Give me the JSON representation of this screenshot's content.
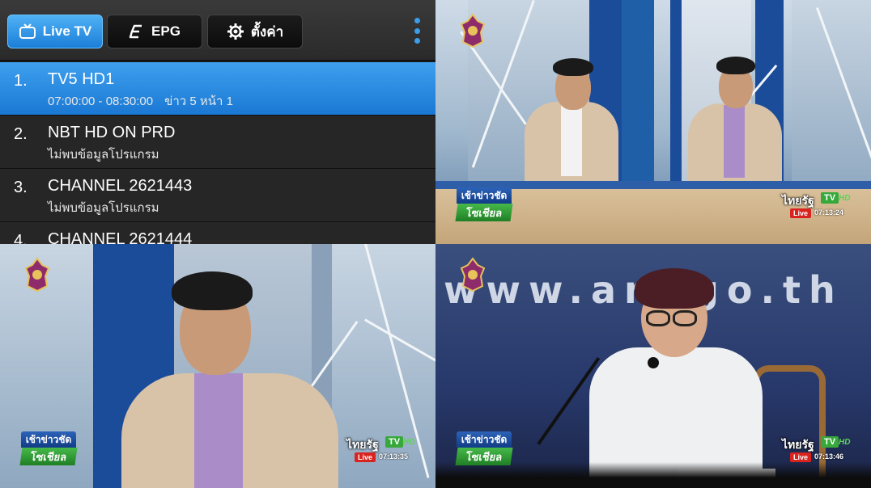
{
  "toolbar": {
    "tabs": [
      {
        "label": "Live TV",
        "icon": "tv-icon",
        "active": true
      },
      {
        "label": "EPG",
        "icon": "epg-icon",
        "active": false
      },
      {
        "label": "ตั้งค่า",
        "icon": "gear-icon",
        "active": false
      }
    ],
    "menu_icon": "overflow-menu-icon"
  },
  "channels": [
    {
      "num": "1.",
      "name": "TV5 HD1",
      "time": "07:00:00 - 08:30:00",
      "program": "ข่าว 5 หน้า 1",
      "selected": true
    },
    {
      "num": "2.",
      "name": "NBT HD ON PRD",
      "program": "ไม่พบข้อมูลโปรแกรม",
      "selected": false
    },
    {
      "num": "3.",
      "name": "CHANNEL 2621443",
      "program": "ไม่พบข้อมูลโปรแกรม",
      "selected": false
    },
    {
      "num": "4.",
      "name": "CHANNEL 2621444",
      "selected": false
    }
  ],
  "video_tiles": [
    {
      "news_tag_top": "เช้าข่าวชัด",
      "news_tag_bottom": "โซเชียล",
      "brand": "ไทยรัฐ",
      "tv": "TV",
      "hd": "HD",
      "live": "Live",
      "time": "07:13:24"
    },
    {
      "news_tag_top": "เช้าข่าวชัด",
      "news_tag_bottom": "โซเชียล",
      "brand": "ไทยรัฐ",
      "tv": "TV",
      "hd": "HD",
      "live": "Live",
      "time": "07:13:35"
    },
    {
      "news_tag_top": "เช้าข่าวชัด",
      "news_tag_bottom": "โซเชียล",
      "brand": "ไทยรัฐ",
      "tv": "TV",
      "hd": "HD",
      "live": "Live",
      "time": "07:13:46",
      "backdrop_text": "www.am  go.th"
    }
  ],
  "colors": {
    "accent": "#2a8be0",
    "panel": "#262626",
    "live_red": "#d8231e",
    "brand_green": "#37a93b"
  }
}
